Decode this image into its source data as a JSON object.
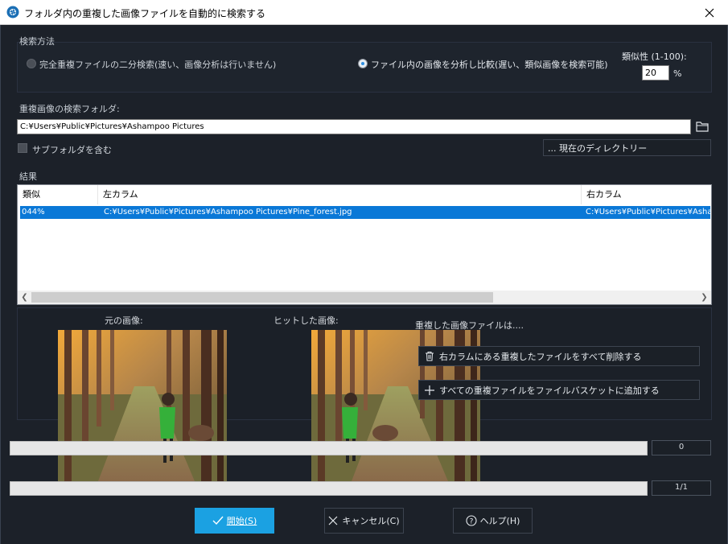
{
  "window": {
    "title": "フォルダ内の重複した画像ファイルを自動的に検索する"
  },
  "search_method": {
    "label": "検索方法",
    "option_binary": "完全重複ファイルの二分検索(速い、画像分析は行いません)",
    "option_analyze": "ファイル内の画像を分析し比較(遅い、類似画像を検索可能)",
    "similarity_label": "類似性 (1-100):",
    "similarity_value": "20",
    "similarity_unit": "%"
  },
  "folder": {
    "label": "重複画像の検索フォルダ:",
    "path": "C:¥Users¥Public¥Pictures¥Ashampoo Pictures",
    "include_subfolders": "サブフォルダを含む",
    "current_dir_button": "... 現在のディレクトリー"
  },
  "results": {
    "label": "結果",
    "columns": [
      "類似",
      "左カラム",
      "右カラム"
    ],
    "rows": [
      {
        "similarity": "044%",
        "left": "C:¥Users¥Public¥Pictures¥Ashampoo Pictures¥Pine_forest.jpg",
        "right": "C:¥Users¥Public¥Pictures¥Asham"
      }
    ]
  },
  "preview": {
    "original_label": "元の画像:",
    "hit_label": "ヒットした画像:",
    "duplicates_label": "重複した画像ファイルは....",
    "delete_button": "右カラムにある重複したファイルをすべて削除する",
    "add_button": "すべての重複ファイルをファイルバスケットに追加する"
  },
  "progress": {
    "value1": "0",
    "value2": "1/1"
  },
  "buttons": {
    "start": "開始(S)",
    "cancel": "キャンセル(C)",
    "help": "ヘルプ(H)"
  },
  "colors": {
    "accent": "#1ba1e2",
    "selection": "#0a78d7",
    "background": "#1c2129"
  }
}
